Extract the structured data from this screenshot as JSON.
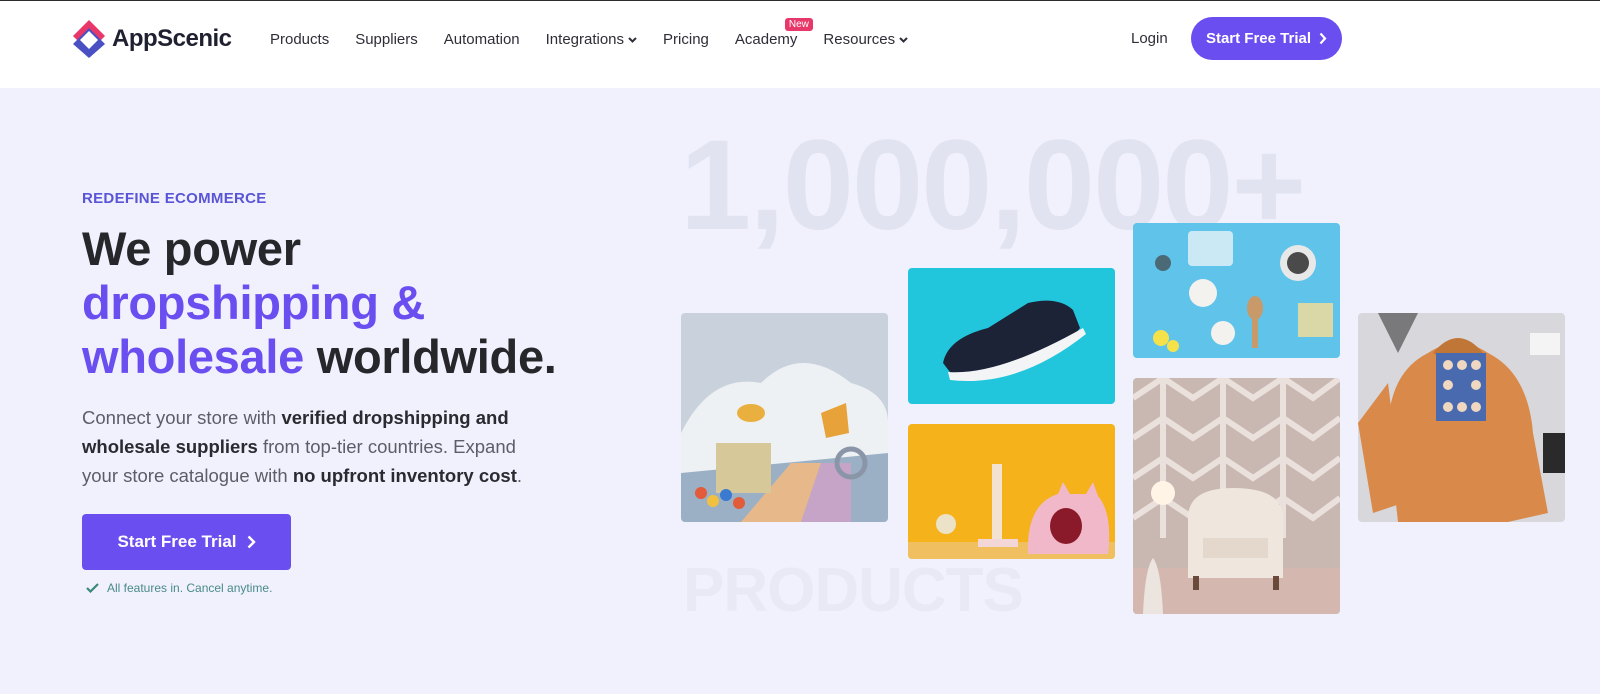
{
  "brand": {
    "name": "AppScenic"
  },
  "nav": {
    "items": [
      {
        "label": "Products",
        "dropdown": false
      },
      {
        "label": "Suppliers",
        "dropdown": false
      },
      {
        "label": "Automation",
        "dropdown": false
      },
      {
        "label": "Integrations",
        "dropdown": true
      },
      {
        "label": "Pricing",
        "dropdown": false
      },
      {
        "label": "Academy",
        "dropdown": false,
        "badge": "New"
      },
      {
        "label": "Resources",
        "dropdown": true
      }
    ],
    "login": "Login",
    "cta": "Start Free Trial"
  },
  "hero": {
    "eyebrow": "REDEFINE ECOMMERCE",
    "headline_1": "We power",
    "headline_2_highlight": "dropshipping &",
    "headline_3_highlight": "wholesale",
    "headline_3_rest": "worldwide.",
    "sub_1": "Connect your store with ",
    "sub_bold_1": "verified dropshipping and wholesale suppliers",
    "sub_2": " from top-tier countries. Expand your store catalogue with ",
    "sub_bold_2": "no upfront inventory cost",
    "sub_3": ".",
    "cta": "Start Free Trial",
    "note": "All features in. Cancel anytime.",
    "big_number": "1,000,000+",
    "big_word": "PRODUCTS"
  },
  "colors": {
    "accent": "#6a4ef0",
    "badge": "#e8386a",
    "background": "#f0f1fd"
  },
  "product_tiles": [
    {
      "name": "kids-toys"
    },
    {
      "name": "sneaker"
    },
    {
      "name": "cat-furniture"
    },
    {
      "name": "cosmetics"
    },
    {
      "name": "armchair"
    },
    {
      "name": "hoodie"
    }
  ]
}
